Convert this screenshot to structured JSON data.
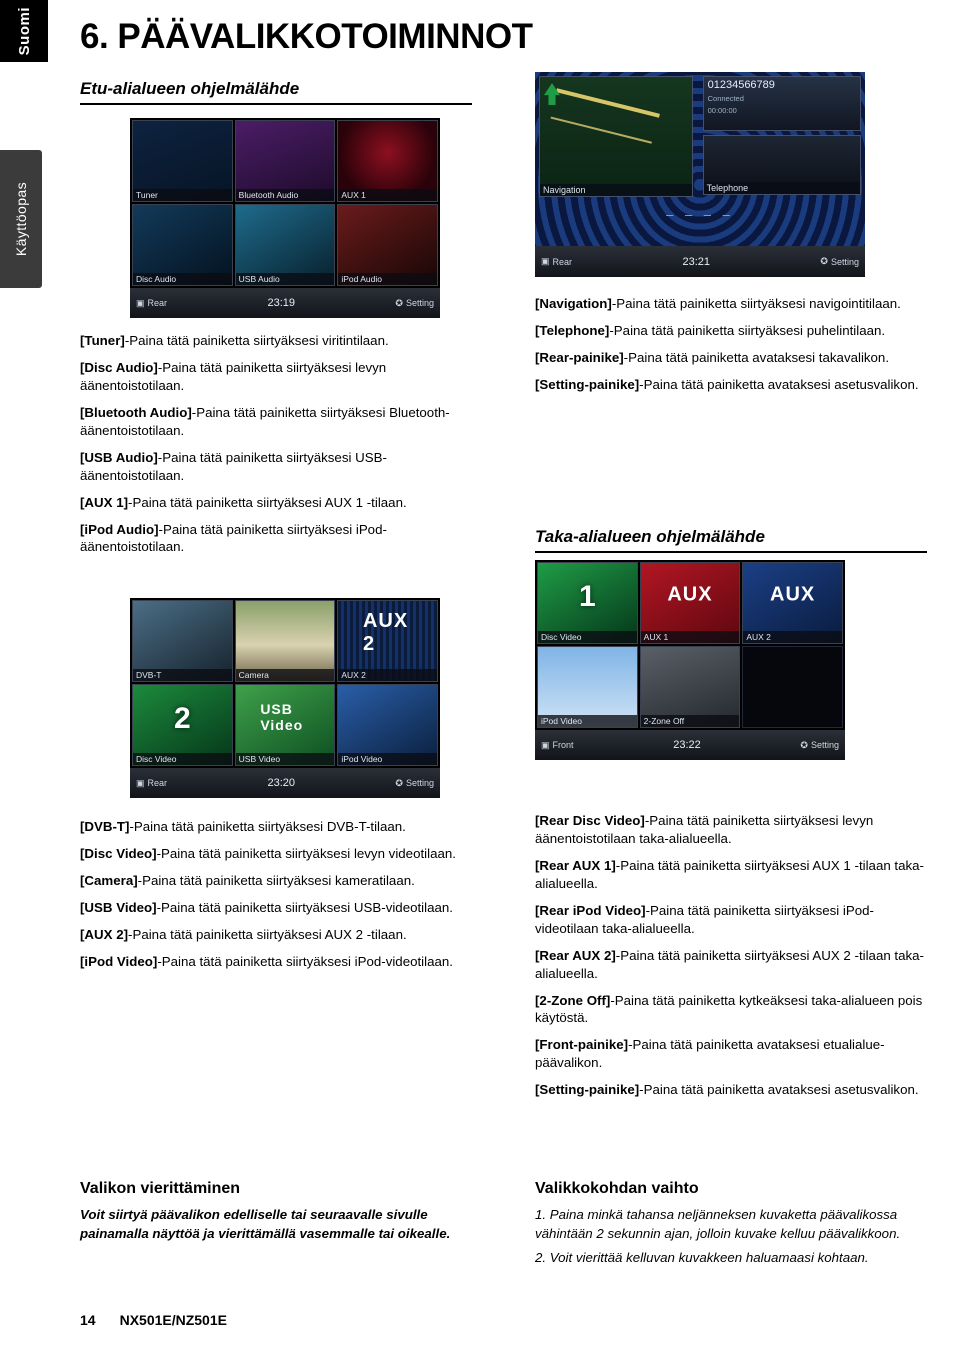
{
  "tabs": {
    "language": "Suomi",
    "section": "Käyttöopas"
  },
  "chapter": {
    "number_title": "6. PÄÄVALIKKOTOIMINNOT",
    "section1": "Etu-alialueen ohjelmälähde",
    "section2": "Taka-alialueen ohjelmälähde"
  },
  "screens": {
    "front_audio": {
      "tiles": [
        {
          "caption": "Tuner",
          "label": ""
        },
        {
          "caption": "Bluetooth Audio",
          "label": ""
        },
        {
          "caption": "AUX 1",
          "label": "AUX 1"
        },
        {
          "caption": "Disc Audio",
          "label": ""
        },
        {
          "caption": "USB Audio",
          "label": ""
        },
        {
          "caption": "iPod Audio",
          "label": ""
        }
      ],
      "rear_button": "Rear",
      "clock": "23:19",
      "setting_button": "Setting"
    },
    "navigation": {
      "map_label": "Navigation",
      "phone_number": "01234566789",
      "connected_label": "Connected",
      "connected_time": "00:00:00",
      "telephone_label": "Telephone",
      "dashes": "– – – –",
      "rear_button": "Rear",
      "clock": "23:21",
      "setting_button": "Setting"
    },
    "front_video": {
      "tiles": [
        {
          "caption": "DVB-T",
          "label": ""
        },
        {
          "caption": "Camera",
          "label": ""
        },
        {
          "caption": "AUX 2",
          "label": "AUX 2"
        },
        {
          "caption": "Disc Video",
          "label": "2"
        },
        {
          "caption": "USB Video",
          "label": "USB Video"
        },
        {
          "caption": "iPod Video",
          "label": ""
        }
      ],
      "rear_button": "Rear",
      "clock": "23:20",
      "setting_button": "Setting"
    },
    "rear_source": {
      "tiles": [
        {
          "caption": "Disc Video",
          "label": "1"
        },
        {
          "caption": "AUX 1",
          "label": "AUX"
        },
        {
          "caption": "AUX 2",
          "label": "AUX"
        },
        {
          "caption": "iPod Video",
          "label": ""
        },
        {
          "caption": "2-Zone Off",
          "label": ""
        }
      ],
      "front_button": "Front",
      "clock": "23:22",
      "setting_button": "Setting"
    }
  },
  "left_column": {
    "audio_items": [
      {
        "key": "[Tuner]",
        "text": "-Paina tätä painiketta siirtyäksesi viritintilaan."
      },
      {
        "key": "[Disc Audio]",
        "text": "-Paina tätä painiketta siirtyäksesi levyn äänentoistotilaan."
      },
      {
        "key": "[Bluetooth Audio]",
        "text": "-Paina tätä painiketta siirtyäksesi Bluetooth-äänentoistotilaan."
      },
      {
        "key": "[USB Audio]",
        "text": "-Paina tätä painiketta siirtyäksesi USB-äänentoistotilaan."
      },
      {
        "key": "[AUX 1]",
        "text": "-Paina tätä painiketta siirtyäksesi AUX 1 -tilaan."
      },
      {
        "key": "[iPod Audio]",
        "text": "-Paina tätä painiketta siirtyäksesi iPod-äänentoistotilaan."
      }
    ],
    "video_items": [
      {
        "key": "[DVB-T]",
        "text": "-Paina tätä painiketta siirtyäksesi DVB-T-tilaan."
      },
      {
        "key": "[Disc Video]",
        "text": "-Paina tätä painiketta siirtyäksesi levyn videotilaan."
      },
      {
        "key": "[Camera]",
        "text": "-Paina tätä painiketta siirtyäksesi kameratilaan."
      },
      {
        "key": "[USB Video]",
        "text": "-Paina tätä painiketta siirtyäksesi USB-videotilaan."
      },
      {
        "key": "[AUX 2]",
        "text": "-Paina tätä painiketta siirtyäksesi AUX 2 -tilaan."
      },
      {
        "key": "[iPod Video]",
        "text": "-Paina tätä painiketta siirtyäksesi iPod-videotilaan."
      }
    ]
  },
  "right_column": {
    "nav_items": [
      {
        "key": "[Navigation]",
        "text": "-Paina tätä painiketta siirtyäksesi navigointitilaan."
      },
      {
        "key": "[Telephone]",
        "text": "-Paina tätä painiketta siirtyäksesi puhelintilaan."
      },
      {
        "key": "[Rear-painike]",
        "text": "-Paina tätä painiketta avataksesi takavalikon."
      },
      {
        "key": "[Setting-painike]",
        "text": "-Paina tätä painiketta avataksesi asetusvalikon."
      }
    ],
    "rear_items": [
      {
        "key": "[Rear Disc Video]",
        "text": "-Paina tätä painiketta siirtyäksesi levyn äänentoistotilaan taka-alialueella."
      },
      {
        "key": "[Rear AUX 1]",
        "text": "-Paina tätä painiketta siirtyäksesi AUX 1 -tilaan taka-alialueella."
      },
      {
        "key": "[Rear iPod Video]",
        "text": "-Paina tätä painiketta siirtyäksesi iPod-videotilaan taka-alialueella."
      },
      {
        "key": "[Rear AUX 2]",
        "text": "-Paina tätä painiketta siirtyäksesi AUX 2 -tilaan taka-alialueella."
      },
      {
        "key": "[2-Zone Off]",
        "text": "-Paina tätä painiketta kytkeäksesi taka-alialueen pois käytöstä."
      },
      {
        "key": "[Front-painike]",
        "text": "-Paina tätä painiketta avataksesi etualialue-päävalikon."
      },
      {
        "key": "[Setting-painike]",
        "text": "-Paina tätä painiketta avataksesi asetusvalikon."
      }
    ]
  },
  "bottom": {
    "left_heading": "Valikon vierittäminen",
    "left_text": "Voit siirtyä päävalikon edelliselle tai seuraavalle sivulle painamalla näyttöä ja vierittämällä vasemmalle tai oikealle.",
    "right_heading": "Valikkokohdan vaihto",
    "right_item1": "1. Paina minkä tahansa neljänneksen kuvaketta päävalikossa vähintään 2 sekunnin ajan, jolloin kuvake kelluu päävalikkoon.",
    "right_item2": "2. Voit vierittää kelluvan kuvakkeen haluamaasi kohtaan."
  },
  "footer": {
    "page_number": "14",
    "model": "NX501E/NZ501E"
  }
}
